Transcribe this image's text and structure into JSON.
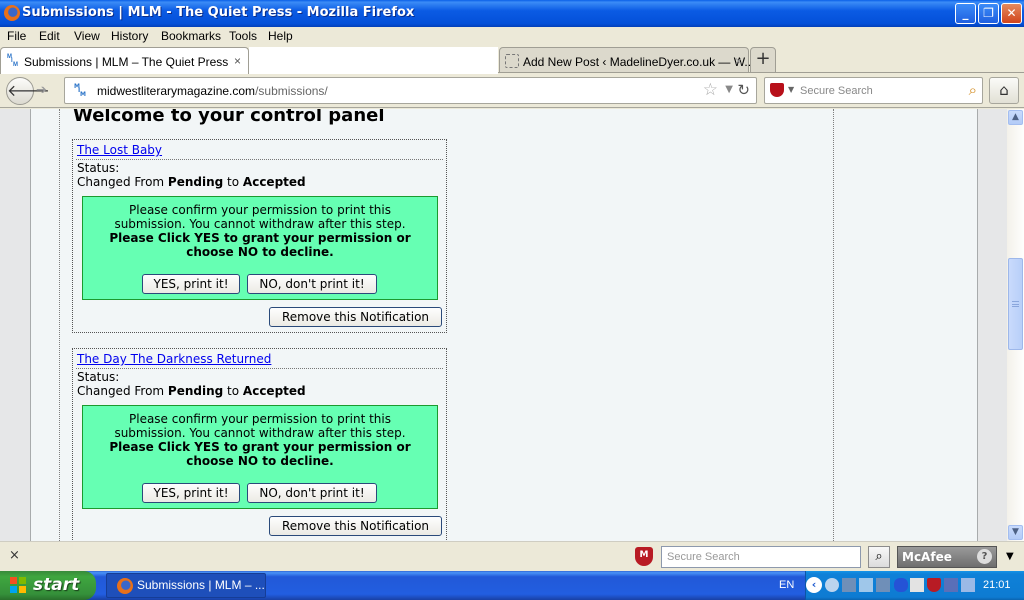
{
  "window": {
    "title": "Submissions | MLM - The Quiet Press - Mozilla Firefox",
    "controls": {
      "minimize": "_",
      "restore": "❐",
      "close": "✕"
    }
  },
  "menu": {
    "items": [
      {
        "label": "File",
        "accel": "F"
      },
      {
        "label": "Edit",
        "accel": "E"
      },
      {
        "label": "View",
        "accel": "V"
      },
      {
        "label": "History",
        "accel": "s"
      },
      {
        "label": "Bookmarks",
        "accel": "B"
      },
      {
        "label": "Tools",
        "accel": "T"
      },
      {
        "label": "Help",
        "accel": "H"
      }
    ]
  },
  "tabs": [
    {
      "label": "Submissions | MLM – The Quiet Press",
      "active": true,
      "close": "×"
    },
    {
      "label": "Add New Post ‹ MadelineDyer.co.uk — W...",
      "active": false,
      "close": "×"
    }
  ],
  "new_tab_label": "+",
  "nav": {
    "back": "🡐",
    "forward": "➔",
    "url_host": "midwestliterarymagazine.com",
    "url_path": "/submissions/",
    "star": "☆",
    "dropdown": "▼",
    "reload": "↻",
    "search_placeholder": "Secure Search",
    "search_icon": "⌕",
    "home": "⌂"
  },
  "page": {
    "heading": "Welcome to your control panel",
    "notifications": [
      {
        "title": "The Lost Baby",
        "status_label": "Status:",
        "change_prefix": "Changed From ",
        "from_status": "Pending",
        "change_mid": " to ",
        "to_status": "Accepted",
        "confirm_message_line1": "Please confirm your permission to print this",
        "confirm_message_line2": "submission. You cannot withdraw after this step.",
        "confirm_bold_line1": "Please Click YES to grant your permission or",
        "confirm_bold_line2": "choose NO to decline.",
        "yes_label": "YES, print it!",
        "no_label": "NO, don't print it!",
        "remove_label": "Remove this Notification"
      },
      {
        "title": "The Day The Darkness Returned",
        "status_label": "Status:",
        "change_prefix": "Changed From ",
        "from_status": "Pending",
        "change_mid": " to ",
        "to_status": "Accepted",
        "confirm_message_line1": "Please confirm your permission to print this",
        "confirm_message_line2": "submission. You cannot withdraw after this step.",
        "confirm_bold_line1": "Please Click YES to grant your permission or",
        "confirm_bold_line2": "choose NO to decline.",
        "yes_label": "YES, print it!",
        "no_label": "NO, don't print it!",
        "remove_label": "Remove this Notification"
      }
    ]
  },
  "scrollbar": {
    "up": "▲",
    "down": "▼"
  },
  "addon_bar": {
    "close": "×",
    "shield_letter": "M",
    "search_placeholder": "Secure Search",
    "search_button": "⌕",
    "brand": "McAfee",
    "help": "?",
    "menu": "▼"
  },
  "taskbar": {
    "start_label": "start",
    "task_label": "Submissions | MLM – ...",
    "language": "EN",
    "tray_chevron": "‹",
    "clock": "21:01"
  },
  "colors": {
    "confirm_bg": "#66ffb3",
    "confirm_border": "#1b9a2e",
    "link": "#0000ee",
    "titlebar": "#0450d8"
  }
}
